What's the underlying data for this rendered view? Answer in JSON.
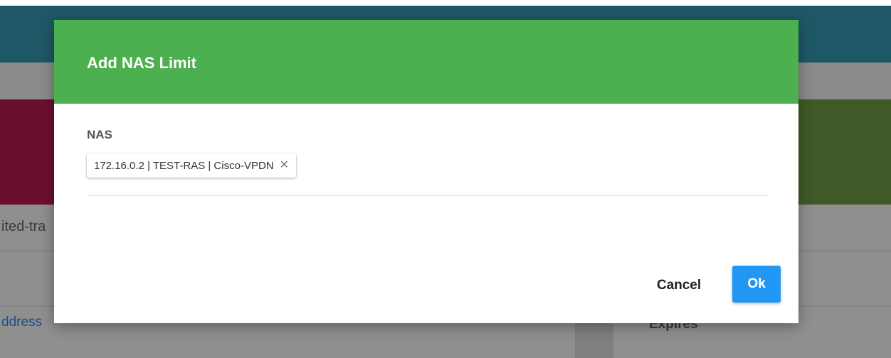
{
  "background": {
    "left_text": "ited-tra",
    "left_link": "ddress",
    "right_header": "Expires"
  },
  "dialog": {
    "title": "Add NAS Limit",
    "field_label": "NAS",
    "selected_chip": "172.16.0.2 | TEST-RAS | Cisco-VPDN",
    "chip_remove_glyph": "✕",
    "cancel_label": "Cancel",
    "ok_label": "Ok"
  },
  "colors": {
    "header_green": "#4caf50",
    "ok_blue": "#2196f3"
  }
}
